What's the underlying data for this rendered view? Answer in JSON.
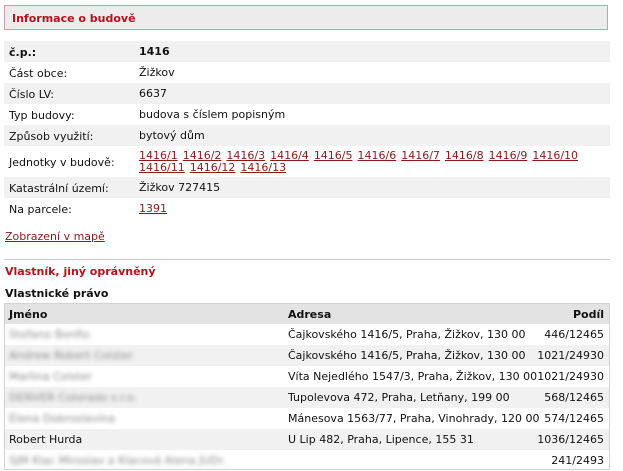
{
  "header": {
    "title": "Informace o budově"
  },
  "info": {
    "cp_label": "č.p.:",
    "cp_value": "1416",
    "cast_label": "Část obce:",
    "cast_value": "Žižkov",
    "lv_label": "Číslo LV:",
    "lv_value": "6637",
    "typ_label": "Typ budovy:",
    "typ_value": "budova s číslem popisným",
    "zpusob_label": "Způsob využití:",
    "zpusob_value": "bytový dům",
    "jednotky_label": "Jednotky v budově:",
    "jednotky": [
      "1416/1",
      "1416/2",
      "1416/3",
      "1416/4",
      "1416/5",
      "1416/6",
      "1416/7",
      "1416/8",
      "1416/9",
      "1416/10",
      "1416/11",
      "1416/12",
      "1416/13"
    ],
    "katastr_label": "Katastrální území:",
    "katastr_value": "Žižkov 727415",
    "parcela_label": "Na parcele:",
    "parcela_value": "1391"
  },
  "map_link": "Zobrazení v mapě",
  "owners": {
    "section_title": "Vlastník, jiný oprávněný",
    "subtitle": "Vlastnické právo",
    "headers": {
      "name": "Jméno",
      "address": "Adresa",
      "share": "Podíl"
    },
    "rows": [
      {
        "name": "Stefano Bonfio",
        "address": "Čajkovského 1416/5, Praha, Žižkov, 130 00",
        "share": "446/12465"
      },
      {
        "name": "Andrew Robert Colster",
        "address": "Čajkovského 1416/5, Praha, Žižkov, 130 00",
        "share": "1021/24930"
      },
      {
        "name": "Marlina Colster",
        "address": "Víta Nejedlého 1547/3, Praha, Žižkov, 130 00",
        "share": "1021/24930"
      },
      {
        "name": "DENVER Colorado s.r.o.",
        "address": "Tupolevova 472, Praha, Letňany, 199 00",
        "share": "568/12465"
      },
      {
        "name": "Elena Dobroslavina",
        "address": "Mánesova 1563/77, Praha, Vinohrady, 120 00",
        "share": "574/12465"
      },
      {
        "name": "Robert Hurda",
        "address": "U Lip 482, Praha, Lipence, 155 31",
        "share": "1036/12465"
      },
      {
        "name": "SJM Klac Miroslav a Klacová Alena JUDr.",
        "address": "",
        "share": "241/2493"
      }
    ]
  }
}
